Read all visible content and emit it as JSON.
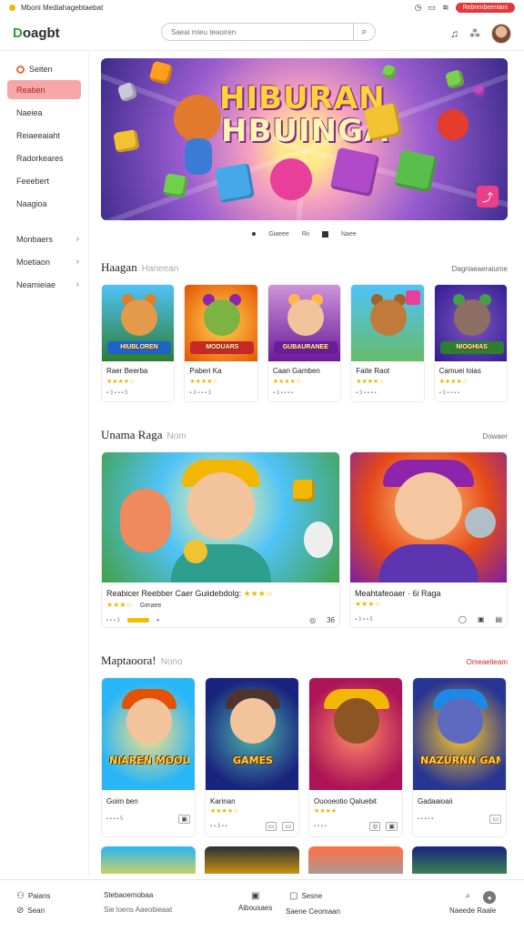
{
  "status": {
    "title": "Mboni Mediahagebtaebat",
    "record_label": "Rebrenbeeniani"
  },
  "header": {
    "logo_a": "D",
    "logo_b": "oagbt",
    "search_placeholder": "Saeai mieu teaoiren"
  },
  "sidebar": {
    "top": "Seiten",
    "items": [
      {
        "label": "Reaben",
        "active": true
      },
      {
        "label": "Naeiea"
      },
      {
        "label": "Reiaeeaiaht"
      },
      {
        "label": "Radorkeares"
      },
      {
        "label": "Feeebert"
      },
      {
        "label": "Naagioa"
      }
    ],
    "groups": [
      {
        "label": "Monbaers"
      },
      {
        "label": "Moetiaon"
      },
      {
        "label": "Neamieiae"
      }
    ]
  },
  "hero": {
    "line1": "HIBURAN",
    "line2": "HBUINGA",
    "nav": [
      "Giaeee",
      "Rii",
      "Naee"
    ]
  },
  "section1": {
    "title": "Haagan",
    "subtitle": "Haneean",
    "more": "Dagriaeaeraiume",
    "cards": [
      {
        "tag": "HIUBLOREN",
        "name": "Raer Beerba",
        "stars": "★★★★☆",
        "meta": "▪ 3 ▪ ▪ ▪ 5"
      },
      {
        "tag": "MODUARS",
        "name": "Paberi Ka",
        "stars": "★★★★☆",
        "meta": "▪ 3 ▪ ▪ ▪ 3"
      },
      {
        "tag": "GUBAURANEE",
        "name": "Caan Gamben",
        "stars": "★★★★☆",
        "meta": "▪ 3 ▪ ▪ ▪ ▪"
      },
      {
        "tag": "",
        "name": "Faite Raot",
        "stars": "★★★★☆",
        "meta": "▪ 3 ▪ ▪ ▪ ▪"
      },
      {
        "tag": "NIOGHIAS",
        "name": "Camuei loias",
        "stars": "★★★★☆",
        "meta": "▪ 3 ▪ ▪ ▪ ▪"
      }
    ]
  },
  "section2": {
    "title": "Unama Raga",
    "subtitle": "Nom",
    "more": "Dowaer",
    "cards": [
      {
        "title": "Reabicer Reebber Caer Guiidebdolg:",
        "stars": "★★★☆",
        "meta_a": "Geraee",
        "meta_b": "▪ ▪ ▪ 3",
        "icons": [
          "◎",
          "36"
        ]
      },
      {
        "title": "Meahtafeoaer · 6i Raga",
        "stars": "★★★☆",
        "meta_a": "",
        "meta_b": "▪ 3 ▪ ▪ 5",
        "icons": [
          "◯",
          "▣",
          "▤"
        ]
      }
    ]
  },
  "section3": {
    "title": "Maptaoora!",
    "subtitle": "Nono",
    "more": "Omeaelieam",
    "cards": [
      {
        "tag": "NIAREN MOOURA",
        "name": "Goim ben",
        "stars": "",
        "meta": "▪ ▪ ▪ ▪ 5",
        "icons": [
          "▣"
        ]
      },
      {
        "tag": "GAMES",
        "name": "Karinan",
        "stars": "★★★★☆",
        "meta": "▪ ▪ 3 ▪ ▪",
        "icons": [
          "▭",
          "▭"
        ]
      },
      {
        "tag": "",
        "name": "Ouooeotio Qaluebit",
        "stars": "★★★★",
        "meta": "▪ ▪ ▪ ▪",
        "icons": [
          "◎",
          "▣"
        ]
      },
      {
        "tag": "NAZURNN GAME",
        "name": "Gadaaioaii",
        "stars": "",
        "meta": "▪ ▪ ▪ ▪ ▪",
        "icons": [
          "▭"
        ]
      }
    ]
  },
  "bottom": {
    "left1": "Paians",
    "left2": "Sean",
    "mid1": "Stebaoemobaa",
    "mid2": "Sie loens Aaeobieaat",
    "c1_label": "Aibousaes",
    "c2_label": "Sesne",
    "c2_sub": "Saene Ceomaan",
    "r_label": "Naeede Raale"
  },
  "colors": {
    "accent": "#e23a3a",
    "active_nav": "#f7a7a7",
    "star": "#f0b400"
  }
}
